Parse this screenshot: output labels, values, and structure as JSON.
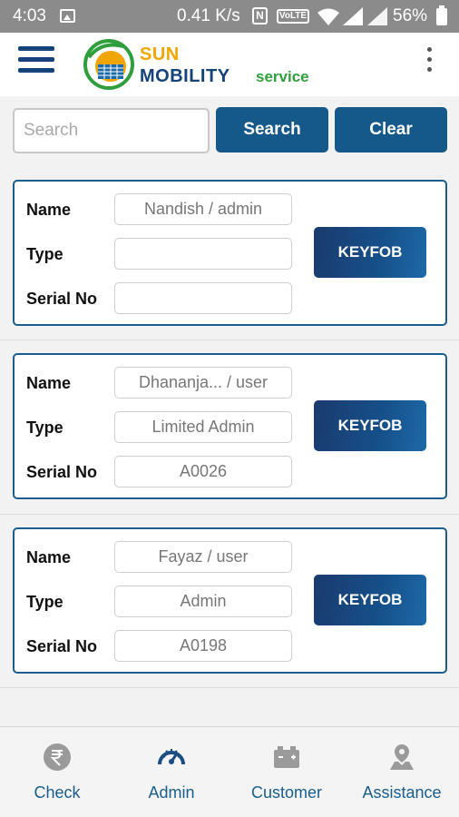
{
  "status_bar": {
    "time": "4:03",
    "speed": "0.41 K/s",
    "nfc": "N",
    "volte": "VoLTE",
    "battery": "56%"
  },
  "header": {
    "logo_line1": "SUN",
    "logo_line2": "MOBILITY",
    "logo_line3": "service",
    "colors": {
      "sun": "#f0a500",
      "mobility": "#14427a",
      "service": "#2f9e3c"
    }
  },
  "search": {
    "placeholder": "Search",
    "value": "",
    "search_label": "Search",
    "clear_label": "Clear"
  },
  "field_labels": {
    "name": "Name",
    "type": "Type",
    "serial": "Serial No"
  },
  "cards": [
    {
      "name": "Nandish / admin",
      "type": "",
      "serial": "",
      "button": "KEYFOB"
    },
    {
      "name": "Dhananja... / user",
      "type": "Limited Admin",
      "serial": "A0026",
      "button": "KEYFOB"
    },
    {
      "name": "Fayaz / user",
      "type": "Admin",
      "serial": "A0198",
      "button": "KEYFOB"
    }
  ],
  "bottom_nav": [
    {
      "label": "Check",
      "icon": "rupee-icon",
      "active": false
    },
    {
      "label": "Admin",
      "icon": "speedometer-icon",
      "active": true
    },
    {
      "label": "Customer",
      "icon": "battery-icon",
      "active": false
    },
    {
      "label": "Assistance",
      "icon": "location-pin-icon",
      "active": false
    }
  ],
  "colors": {
    "primary": "#15598a",
    "card_border": "#1a5d8f",
    "active_icon": "#1a4d80",
    "inactive_icon": "#9a9a9a"
  }
}
